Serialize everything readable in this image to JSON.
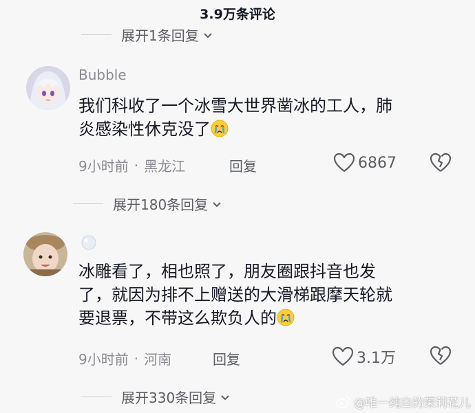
{
  "header": {
    "title": "3.9万条评论"
  },
  "expand_top": {
    "label": "展开1条回复"
  },
  "comments": [
    {
      "username": "Bubble",
      "text_line1": "我们科收了一个冰雪大世界凿冰的工人，肺",
      "text_line2": "炎感染性休克没了",
      "time": "9小时前",
      "dot": "·",
      "location": "黑龙江",
      "reply_label": "回复",
      "likes": "6867",
      "expand_label": "展开180条回复"
    },
    {
      "username": "",
      "text_line1": "冰雕看了，相也照了，朋友圈跟抖音也发",
      "text_line2": "了，就因为排不上赠送的大滑梯跟摩天轮就",
      "text_line3": "要退票，不带这么欺负人的",
      "time": "9小时前",
      "dot": "·",
      "location": "河南",
      "reply_label": "回复",
      "likes": "3.1万",
      "expand_label": "展开330条回复"
    }
  ],
  "watermark": {
    "text": "@唯一纯白的茉莉花儿"
  },
  "icons": {
    "heart": "heart-icon",
    "broken_heart": "broken-heart-icon",
    "chevron": "chevron-down-icon",
    "emoji": "crying-face-icon",
    "weibo": "weibo-icon"
  },
  "colors": {
    "background": "#f7f7f7",
    "text": "#161823",
    "muted": "#8a8b91"
  }
}
